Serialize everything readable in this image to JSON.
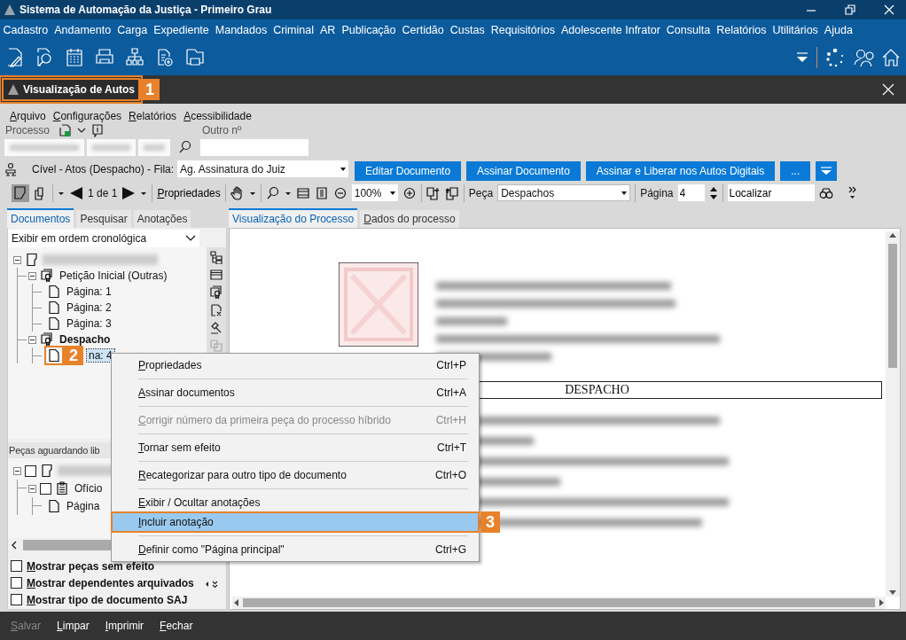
{
  "window": {
    "title": "Sistema de Automação da Justiça - Primeiro Grau"
  },
  "main_menu": [
    "Cadastro",
    "Andamento",
    "Carga",
    "Expediente",
    "Mandados",
    "Criminal",
    "AR",
    "Publicação",
    "Certidão",
    "Custas",
    "Requisitórios",
    "Adolescente Infrator",
    "Consulta",
    "Relatórios",
    "Utilitários",
    "Ajuda"
  ],
  "document_tab": {
    "title": "Visualização de Autos",
    "callout": "1"
  },
  "sub_menu": [
    "Arquivo",
    "Configurações",
    "Relatórios",
    "Acessibilidade"
  ],
  "process": {
    "label": "Processo",
    "other_label": "Outro nº"
  },
  "queue": {
    "label": "Cível - Atos (Despacho) - Fila:",
    "value": "Ag. Assinatura do Juiz"
  },
  "actions": [
    {
      "label": "Editar Documento"
    },
    {
      "label": "Assinar Documento"
    },
    {
      "label": "Assinar e Liberar nos Autos Digitais"
    },
    {
      "label": "..."
    }
  ],
  "viewer_toolbar": {
    "pager": "1 de 1",
    "properties": "Propriedades",
    "zoom": "100%",
    "piece_label": "Peça",
    "piece": "Despachos",
    "page_label": "Página",
    "page": "4",
    "find": "Localizar"
  },
  "left_tabs": [
    {
      "label": "Documentos",
      "selected": true
    },
    {
      "label": "Pesquisar",
      "selected": false
    },
    {
      "label": "Anotações",
      "selected": false
    }
  ],
  "order": "Exibir em ordem cronológica",
  "tree": [
    {
      "kind": "process",
      "expanded": true,
      "children": [
        {
          "kind": "piece",
          "label": "Petição Inicial (Outras)",
          "current": false,
          "expanded": true,
          "children": [
            {
              "kind": "page",
              "label": "Página: 1",
              "selected": false
            },
            {
              "kind": "page",
              "label": "Página: 2",
              "selected": false
            },
            {
              "kind": "page",
              "label": "Página: 3",
              "selected": false
            }
          ]
        },
        {
          "kind": "piece",
          "label": "Despacho",
          "current": true,
          "expanded": true,
          "children": [
            {
              "kind": "page",
              "label": "na: 4",
              "selected": true,
              "callout": "2"
            }
          ]
        }
      ]
    }
  ],
  "pending": {
    "title": "Peças aguardando lib",
    "tree": [
      {
        "kind": "process",
        "checked": false,
        "expanded": true,
        "children": [
          {
            "kind": "office",
            "label": "Ofício",
            "checked": false,
            "expanded": true,
            "children": [
              {
                "kind": "page",
                "label": "Página"
              }
            ]
          }
        ]
      }
    ]
  },
  "options": [
    {
      "label": "Mostrar peças sem efeito",
      "checked": false
    },
    {
      "label": "Mostrar dependentes arquivados",
      "checked": false
    },
    {
      "label": "Mostrar tipo de documento SAJ",
      "checked": false
    }
  ],
  "viewer_tabs": [
    {
      "label": "Visualização do Processo",
      "selected": true
    },
    {
      "label": "Dados do processo",
      "selected": false
    }
  ],
  "document": {
    "heading": "DESPACHO"
  },
  "context_menu": [
    [
      {
        "label": "Propriedades",
        "shortcut": "Ctrl+P",
        "disabled": false,
        "selected": false
      }
    ],
    [
      {
        "label": "Assinar documentos",
        "shortcut": "Ctrl+A",
        "disabled": false,
        "selected": false
      }
    ],
    [
      {
        "label": "Corrigir número da primeira peça do processo híbrido",
        "shortcut": "Ctrl+H",
        "disabled": true,
        "selected": false
      }
    ],
    [
      {
        "label": "Tornar sem efeito",
        "shortcut": "Ctrl+T",
        "disabled": false,
        "selected": false
      }
    ],
    [
      {
        "label": "Recategorizar para outro tipo de documento",
        "shortcut": "Ctrl+O",
        "disabled": false,
        "selected": false
      }
    ],
    [
      {
        "label": "Exibir / Ocultar anotações",
        "disabled": false,
        "selected": false
      },
      {
        "label": "Incluir anotação",
        "disabled": false,
        "selected": true,
        "callout": "3"
      }
    ],
    [
      {
        "label": "Definir como \"Página principal\"",
        "shortcut": "Ctrl+G",
        "disabled": false,
        "selected": false
      }
    ]
  ],
  "footer": [
    {
      "label": "Salvar",
      "disabled": true
    },
    {
      "label": "Limpar",
      "disabled": false
    },
    {
      "label": "Imprimir",
      "disabled": false
    },
    {
      "label": "Fechar",
      "disabled": false
    }
  ]
}
